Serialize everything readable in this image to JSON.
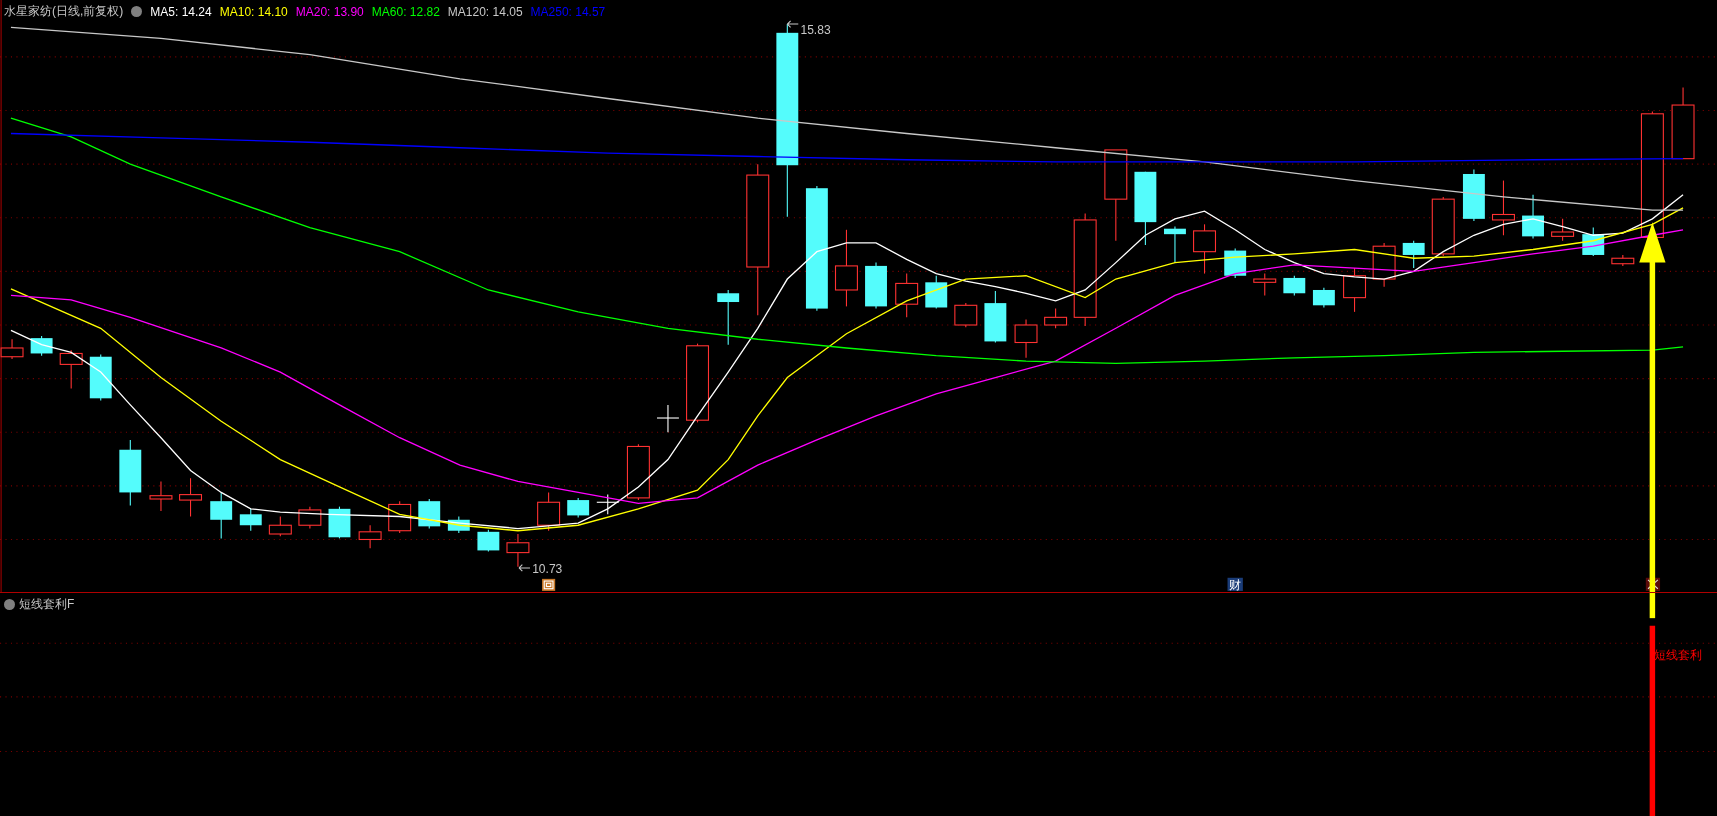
{
  "chart_header": {
    "title": "水星家纺(日线,前复权)",
    "ma_legend": [
      {
        "label": "MA5: 14.24",
        "color": "#ffffff"
      },
      {
        "label": "MA10: 14.10",
        "color": "#ffff00"
      },
      {
        "label": "MA20: 13.90",
        "color": "#ff00ff"
      },
      {
        "label": "MA60: 12.82",
        "color": "#00ff00"
      },
      {
        "label": "MA120: 14.05",
        "color": "#c8c8c8"
      },
      {
        "label": "MA250: 14.57",
        "color": "#0000ff"
      }
    ]
  },
  "price_labels": {
    "high": "15.83",
    "low": "10.73"
  },
  "event_markers": [
    {
      "kind": "icon"
    },
    {
      "kind": "text",
      "label": "财"
    },
    {
      "kind": "signal-icon"
    }
  ],
  "indicator_panel": {
    "title": "短线套利F",
    "signal_label": "短线套利"
  }
}
